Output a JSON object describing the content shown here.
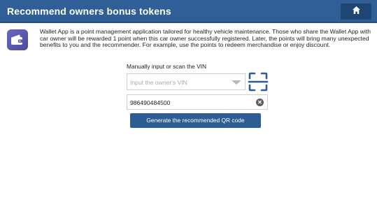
{
  "header": {
    "title": "Recommend owners bonus tokens",
    "home_icon": "home-icon"
  },
  "intro": {
    "icon": "wallet-app-icon",
    "text": "Wallet App is a point management application tailored for healthy vehicle maintenance. Those who share the Wallet App with car owner will be rewarded 1 point when this car owner successfully registered. Later, the points will bring many unexpected benefits to you and the recommender. For example, use the points to redeem merchandise or enjoy discount."
  },
  "vin": {
    "label": "Manually input or scan the VIN",
    "select_placeholder": "Input the owner's VIN",
    "scan_icon": "scan-frame-icon",
    "input_value": "986490484500",
    "clear_icon": "clear-icon"
  },
  "actions": {
    "generate_label": "Generate the recommended QR code"
  },
  "colors": {
    "header_bg": "#2f5f96",
    "button_bg": "#2e5d93",
    "icon_bg": "#5a59b0"
  }
}
